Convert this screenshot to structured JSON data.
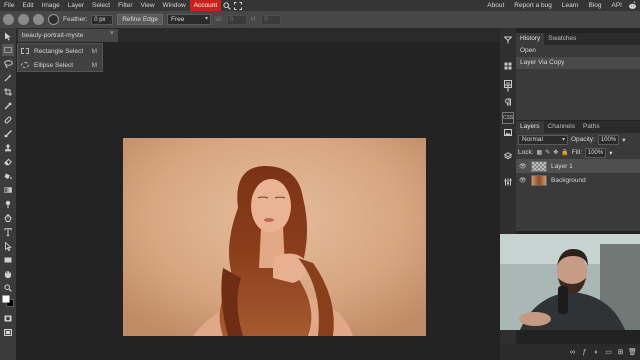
{
  "menu": {
    "items": [
      "File",
      "Edit",
      "Image",
      "Layer",
      "Select",
      "Filter",
      "View",
      "Window"
    ],
    "account": "Account",
    "right_links": [
      "About",
      "Report a bug",
      "Learn",
      "Blog",
      "API"
    ],
    "icons": [
      "search-icon",
      "fullscreen-icon",
      "reddit-icon"
    ]
  },
  "options": {
    "feather_label": "Feather:",
    "feather_value": "0 px",
    "refine_edge": "Refine Edge",
    "mode": "Free",
    "w_label": "W:",
    "w_value": "0",
    "h_label": "H:",
    "h_value": "0"
  },
  "document": {
    "tab_title": "beauty-portrait-myste"
  },
  "flyout": {
    "items": [
      {
        "label": "Rectangle Select",
        "shortcut": "M",
        "icon": "rect-select-icon"
      },
      {
        "label": "Ellipse Select",
        "shortcut": "M",
        "icon": "ellipse-select-icon"
      }
    ]
  },
  "history": {
    "tabs": [
      "History",
      "Swatches"
    ],
    "active_tab": "History",
    "entries": [
      "Open",
      "Layer Via Copy"
    ]
  },
  "layers": {
    "tabs": [
      "Layers",
      "Channels",
      "Paths"
    ],
    "blend_mode": "Normal",
    "opacity_label": "Opacity:",
    "opacity_value": "100%",
    "lock_label": "Lock:",
    "fill_label": "Fill:",
    "fill_value": "100%",
    "items": [
      {
        "name": "Layer 1",
        "selected": true
      },
      {
        "name": "Background",
        "selected": false
      }
    ]
  },
  "strip": {
    "css_label": "CSS"
  },
  "colors": {
    "accent_account": "#c8201b",
    "menubar": "#353535",
    "panel": "#3a3a3a"
  }
}
